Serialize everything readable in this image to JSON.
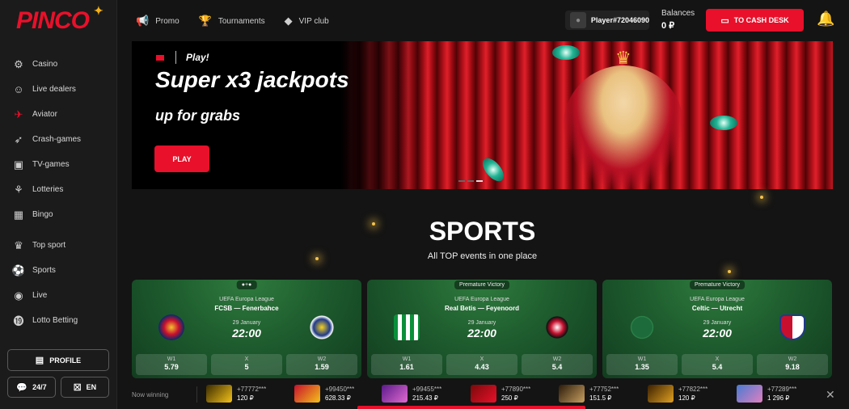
{
  "brand": {
    "logo_text": "PINCO",
    "accent": "#e8102a"
  },
  "sidebar": {
    "items": [
      {
        "label": "Casino",
        "icon": "casino-icon"
      },
      {
        "label": "Live dealers",
        "icon": "dealer-icon"
      },
      {
        "label": "Aviator",
        "icon": "plane-icon"
      },
      {
        "label": "Crash-games",
        "icon": "rocket-icon"
      },
      {
        "label": "TV-games",
        "icon": "tv-icon"
      },
      {
        "label": "Lotteries",
        "icon": "lottery-icon"
      },
      {
        "label": "Bingo",
        "icon": "bingo-icon"
      },
      {
        "label": "Top sport",
        "icon": "trophy-icon"
      },
      {
        "label": "Sports",
        "icon": "ball-icon"
      },
      {
        "label": "Live",
        "icon": "live-icon"
      },
      {
        "label": "Lotto Betting",
        "icon": "lotto-icon"
      }
    ],
    "profile_label": "PROFILE",
    "support_label": "24/7",
    "language_label": "EN"
  },
  "header": {
    "nav": [
      {
        "label": "Promo",
        "icon": "megaphone-icon"
      },
      {
        "label": "Tournaments",
        "icon": "trophy-icon"
      },
      {
        "label": "VIP club",
        "icon": "diamond-icon"
      }
    ],
    "player": "Player#72046090",
    "balance_label": "Balances",
    "balance_value": "0 ₽",
    "cash_button": "TO CASH DESK"
  },
  "banner": {
    "tag": "Play!",
    "title": "Super x3 jackpots",
    "subtitle": "up for grabs",
    "button": "PLAY",
    "slides": 3,
    "active_slide": 3
  },
  "sports": {
    "title": "SPORTS",
    "subtitle": "All TOP events in one place",
    "cards": [
      {
        "badge": "●+●",
        "league": "UEFA Europa League",
        "home": "FCSB",
        "away": "Fenerbahce",
        "date": "29 January",
        "time": "22:00",
        "odds": [
          {
            "k": "W1",
            "v": "5.79"
          },
          {
            "k": "X",
            "v": "5"
          },
          {
            "k": "W2",
            "v": "1.59"
          }
        ]
      },
      {
        "badge": "Premature Victory",
        "league": "UEFA Europa League",
        "home": "Real Betis",
        "away": "Feyenoord",
        "date": "29 January",
        "time": "22:00",
        "odds": [
          {
            "k": "W1",
            "v": "1.61"
          },
          {
            "k": "X",
            "v": "4.43"
          },
          {
            "k": "W2",
            "v": "5.4"
          }
        ]
      },
      {
        "badge": "Premature Victory",
        "league": "UEFA Europa League",
        "home": "Celtic",
        "away": "Utrecht",
        "date": "29 January",
        "time": "22:00",
        "odds": [
          {
            "k": "W1",
            "v": "1.35"
          },
          {
            "k": "X",
            "v": "5.4"
          },
          {
            "k": "W2",
            "v": "9.18"
          }
        ]
      }
    ]
  },
  "ticker": {
    "label": "Now winning",
    "wins": [
      {
        "user": "+77772***",
        "amount": "120 ₽"
      },
      {
        "user": "+99450***",
        "amount": "628.33 ₽"
      },
      {
        "user": "+99455***",
        "amount": "215.43 ₽"
      },
      {
        "user": "+77890***",
        "amount": "250 ₽"
      },
      {
        "user": "+77752***",
        "amount": "151.5 ₽"
      },
      {
        "user": "+77822***",
        "amount": "120 ₽"
      },
      {
        "user": "+77289***",
        "amount": "1 296 ₽"
      }
    ]
  }
}
